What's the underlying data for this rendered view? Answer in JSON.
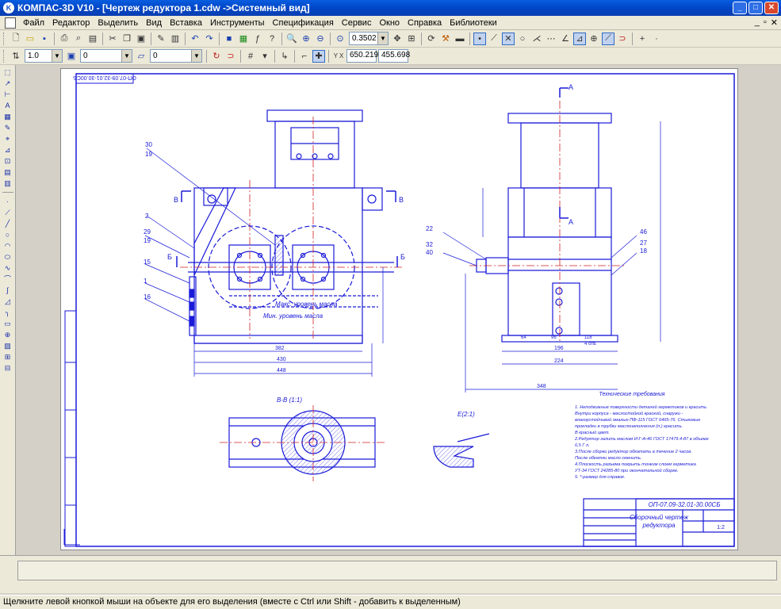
{
  "window": {
    "title": "КОМПАС-3D V10 - [Чертеж редуктора 1.cdw ->Системный вид]",
    "app_icon": "kompas-icon"
  },
  "menu": {
    "items": [
      "Файл",
      "Редактор",
      "Выделить",
      "Вид",
      "Вставка",
      "Инструменты",
      "Спецификация",
      "Сервис",
      "Окно",
      "Справка",
      "Библиотеки"
    ]
  },
  "toolbar": {
    "zoom_value": "0.3502",
    "cursor_x": "650.219",
    "cursor_y": "455.698",
    "line_scale": "1.0",
    "layer_value": "0",
    "style_value": "0"
  },
  "drawing": {
    "doc_number_corner": "ОП-07.09-32.01-30.00СБ",
    "title_doc_number": "ОП-07.09-32.01-30.00СБ",
    "title_name_line1": "Сборочный чертеж",
    "title_name_line2": "редуктора",
    "section_bb": "В-В (1:1)",
    "detail_e": "Е(2:1)",
    "tech_req_title": "Технические требования",
    "tech_req_lines": [
      "1. Неподвижные поверхности деталей герметиков и красить",
      "Внутри корпуса - маслостойкой краской, снаружи -",
      "влагоустойчивой эмалью ПФ-115 ГОСТ 6465-76. Стыковые",
      "прокладки в трубки маслонаполнения (п.) красить.",
      "В красный цвет.",
      "2.Редуктор залить маслом И-Г-А-46 ГОСТ 17479.4-87 в объеме",
      "6,5 Г л.",
      "3.После сборки редуктор обкатать в течение 2 часов.",
      "После обкатки масло сменить.",
      "4.Плоскость разъема покрыть тонким слоем герметика",
      "УТ-34 ГОСТ 24285-80 при окончательной сборке.",
      "5. *-размер для справок."
    ],
    "leader_labels": [
      "30",
      "19",
      "2",
      "29",
      "19",
      "15",
      "1",
      "16",
      "22",
      "32",
      "40",
      "46",
      "27",
      "18"
    ],
    "view_markers": [
      "В",
      "В",
      "Б",
      "Б",
      "А",
      "А"
    ],
    "note_max_level": "Макс. уровень масла",
    "note_min_level": "Мин. уровень масла",
    "dim_bottom_1": "382",
    "dim_bottom_2": "430",
    "dim_bottom_3": "448",
    "dim_side_1": "196",
    "dim_side_2": "224",
    "dim_side_3": "348",
    "dim_small": [
      "64",
      "96",
      "118",
      "4 отв."
    ],
    "scale_cell": "1:2"
  },
  "status": {
    "text": "Щелкните левой кнопкой мыши на объекте для его выделения (вместе с Ctrl или Shift - добавить к выделенным)"
  },
  "colors": {
    "drawing_line": "#1a1ad8",
    "axis_line": "#d02020",
    "title_bar": "#0a5ddf"
  }
}
